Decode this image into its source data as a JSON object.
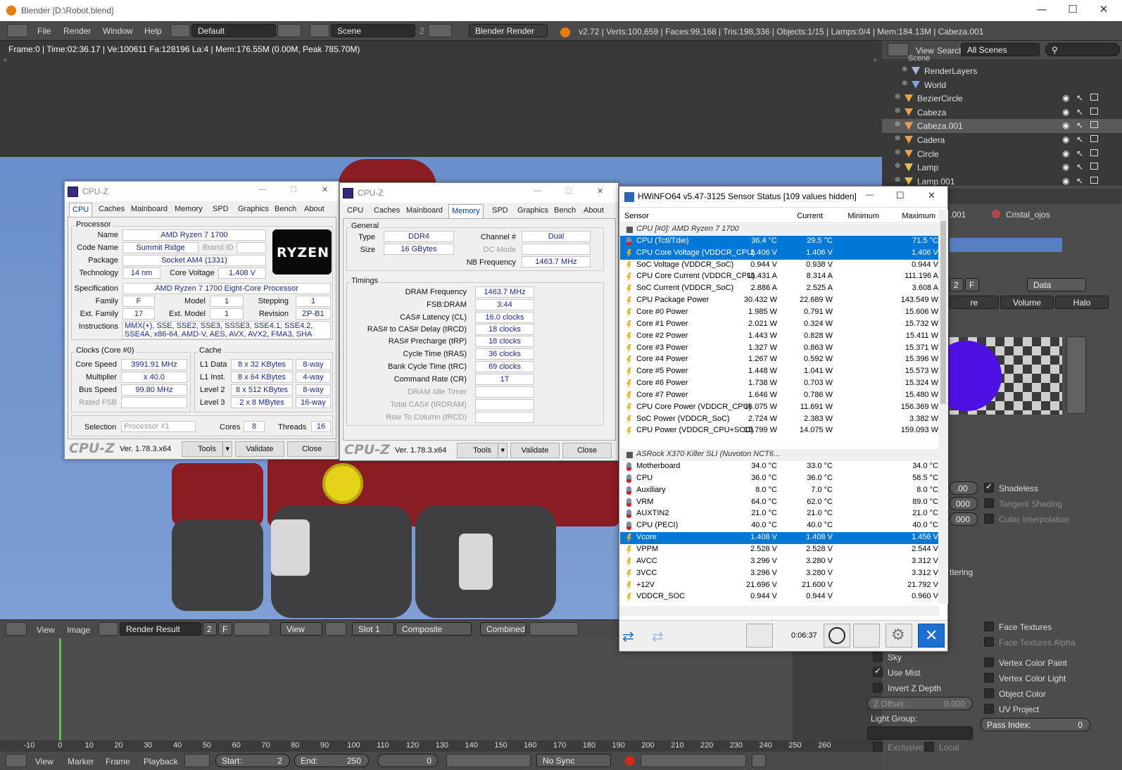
{
  "blender": {
    "title": "Blender  [D:\\Robot.blend]",
    "menu": [
      "File",
      "Render",
      "Window",
      "Help"
    ],
    "layout": "Default",
    "scene": "Scene",
    "scene_count": "2",
    "engine": "Blender Render",
    "stats": "v2.72 | Verts:100,659 | Faces:99,168 | Tris:198,336 | Objects:1/15 | Lamps:0/4 | Mem:184.13M | Cabeza.001",
    "viewport_info": "Frame:0 | Time:02:36.17 | Ve:100611 Fa:128196 La:4 | Mem:176.55M (0.00M, Peak 785.70M)",
    "image_editor": {
      "menus": [
        "View",
        "Image"
      ],
      "image_name": "Render Result",
      "users": "2",
      "fake": "F",
      "view_label": "View",
      "slot": "Slot 1",
      "composite": "Composite",
      "pass": "Combined"
    },
    "timeline": {
      "ticks": [
        "-10",
        "0",
        "10",
        "20",
        "30",
        "40",
        "50",
        "60",
        "70",
        "80",
        "90",
        "100",
        "110",
        "120",
        "130",
        "140",
        "150",
        "160",
        "170",
        "180",
        "190",
        "200",
        "210",
        "220",
        "230",
        "240",
        "250",
        "260"
      ],
      "menus": [
        "View",
        "Marker",
        "Frame",
        "Playback"
      ],
      "start_label": "Start:",
      "start": "2",
      "end_label": "End:",
      "end": "250",
      "current": "0",
      "sync": "No Sync"
    },
    "outliner": {
      "menus": [
        "View",
        "Search"
      ],
      "filter": "All Scenes",
      "top_item": "Scene",
      "items": [
        "RenderLayers",
        "World",
        "BezierCircle",
        "Cabeza",
        "Cabeza.001",
        "Cadera",
        "Circle",
        "Lamp",
        "Lamp.001"
      ]
    },
    "properties": {
      "breadcrumb_obj": ".001",
      "breadcrumb_mat": "Cristal_ojos",
      "data_dropdown": "Data",
      "tabs": [
        "re",
        "Volume",
        "Halo"
      ],
      "users": "2",
      "fake": "F",
      "shadeless": "Shadeless",
      "tangent_shading": "Tangent Shading",
      "cubic_interpolation": "Cubic Interpolation",
      "val_1": ".00",
      "val_2": "000",
      "val_3": "000",
      "scattering": "ttering",
      "face_textures": "Face Textures",
      "face_textures_alpha": "Face Textures Alpha",
      "sky": "Sky",
      "use_mist": "Use Mist",
      "vertex_color_paint": "Vertex Color Paint",
      "invert_z_depth": "Invert Z Depth",
      "vertex_color_light": "Vertex Color Light",
      "object_color": "Object Color",
      "z_offset_label": "Z Offset:",
      "z_offset": "0.000",
      "uv_project": "UV Project",
      "light_group": "Light Group:",
      "pass_index_label": "Pass Index:",
      "pass_index": "0",
      "exclusive": "Exclusive",
      "local": "Local"
    }
  },
  "cpuz1": {
    "title": "CPU-Z",
    "tabs": [
      "CPU",
      "Caches",
      "Mainboard",
      "Memory",
      "SPD",
      "Graphics",
      "Bench",
      "About"
    ],
    "processor_group": "Processor",
    "name_label": "Name",
    "name": "AMD Ryzen 7 1700",
    "codename_label": "Code Name",
    "codename": "Summit Ridge",
    "brandid_label": "Brand ID",
    "package_label": "Package",
    "package": "Socket AM4 (1331)",
    "technology_label": "Technology",
    "technology": "14 nm",
    "corevoltage_label": "Core Voltage",
    "corevoltage": "1.408 V",
    "logo_text": "RYZEN",
    "spec_label": "Specification",
    "spec": "AMD Ryzen 7 1700 Eight-Core Processor",
    "family_label": "Family",
    "family": "F",
    "model_label": "Model",
    "model": "1",
    "stepping_label": "Stepping",
    "stepping": "1",
    "extfamily_label": "Ext. Family",
    "extfamily": "17",
    "extmodel_label": "Ext. Model",
    "extmodel": "1",
    "revision_label": "Revision",
    "revision": "ZP-B1",
    "instr_label": "Instructions",
    "instr": "MMX(+), SSE, SSE2, SSE3, SSSE3, SSE4.1, SSE4.2, SSE4A, x86-64, AMD-V, AES, AVX, AVX2, FMA3, SHA",
    "clocks_group": "Clocks (Core #0)",
    "corespeed_label": "Core Speed",
    "corespeed": "3991.91 MHz",
    "multiplier_label": "Multiplier",
    "multiplier": "x 40.0",
    "busspeed_label": "Bus Speed",
    "busspeed": "99.80 MHz",
    "ratedfsb_label": "Rated FSB",
    "cache_group": "Cache",
    "l1d_label": "L1 Data",
    "l1d": "8 x 32 KBytes",
    "l1d_way": "8-way",
    "l1i_label": "L1 Inst.",
    "l1i": "8 x 64 KBytes",
    "l1i_way": "4-way",
    "l2_label": "Level 2",
    "l2": "8 x 512 KBytes",
    "l2_way": "8-way",
    "l3_label": "Level 3",
    "l3": "2 x 8 MBytes",
    "l3_way": "16-way",
    "selection_label": "Selection",
    "selection": "Processor #1",
    "cores_label": "Cores",
    "cores": "8",
    "threads_label": "Threads",
    "threads": "16",
    "brand": "CPU-Z",
    "version": "Ver. 1.78.3.x64",
    "tools": "Tools",
    "validate": "Validate",
    "close": "Close"
  },
  "cpuz2": {
    "title": "CPU-Z",
    "tabs": [
      "CPU",
      "Caches",
      "Mainboard",
      "Memory",
      "SPD",
      "Graphics",
      "Bench",
      "About"
    ],
    "general_group": "General",
    "type_label": "Type",
    "type": "DDR4",
    "channel_label": "Channel #",
    "channel": "Dual",
    "size_label": "Size",
    "size": "16 GBytes",
    "dcmode_label": "DC Mode",
    "nbfreq_label": "NB Frequency",
    "nbfreq": "1463.7 MHz",
    "timings_group": "Timings",
    "dramfreq_label": "DRAM Frequency",
    "dramfreq": "1463.7 MHz",
    "fsbdram_label": "FSB:DRAM",
    "fsbdram": "3:44",
    "cas_label": "CAS# Latency (CL)",
    "cas": "16.0 clocks",
    "trcd_label": "RAS# to CAS# Delay (tRCD)",
    "trcd": "18 clocks",
    "trp_label": "RAS# Precharge (tRP)",
    "trp": "18 clocks",
    "tras_label": "Cycle Time (tRAS)",
    "tras": "36 clocks",
    "trc_label": "Bank Cycle Time (tRC)",
    "trc": "69 clocks",
    "cr_label": "Command Rate (CR)",
    "cr": "1T",
    "idle_label": "DRAM Idle Timer",
    "totalcas_label": "Total CAS# (tRDRAM)",
    "rowcol_label": "Row To Column (tRCD)",
    "brand": "CPU-Z",
    "version": "Ver. 1.78.3.x64",
    "tools": "Tools",
    "validate": "Validate",
    "close": "Close"
  },
  "hwinfo": {
    "title": "HWiNFO64 v5.47-3125 Sensor Status [109 values hidden]",
    "columns": [
      "Sensor",
      "Current",
      "Minimum",
      "Maximum"
    ],
    "rows": [
      {
        "name": "CPU [#0]: AMD Ryzen 7 1700",
        "cur": "",
        "min": "",
        "max": "",
        "kind": "group"
      },
      {
        "name": "CPU (Tctl/Tdie)",
        "cur": "36.4 °C",
        "min": "29.5 °C",
        "max": "71.5 °C",
        "kind": "temp",
        "sel": true
      },
      {
        "name": "CPU Core Voltage (VDDCR_CPU)",
        "cur": "1.406 V",
        "min": "1.406 V",
        "max": "1.406 V",
        "kind": "volt",
        "sel": true
      },
      {
        "name": "SoC Voltage (VDDCR_SoC)",
        "cur": "0.944 V",
        "min": "0.938 V",
        "max": "0.944 V",
        "kind": "volt"
      },
      {
        "name": "CPU Core Current (VDDCR_CPU)",
        "cur": "11.431 A",
        "min": "8.314 A",
        "max": "111.196 A",
        "kind": "volt"
      },
      {
        "name": "SoC Current (VDDCR_SoC)",
        "cur": "2.886 A",
        "min": "2.525 A",
        "max": "3.608 A",
        "kind": "volt"
      },
      {
        "name": "CPU Package Power",
        "cur": "30.432 W",
        "min": "22.689 W",
        "max": "143.549 W",
        "kind": "volt"
      },
      {
        "name": "Core #0 Power",
        "cur": "1.985 W",
        "min": "0.791 W",
        "max": "15.606 W",
        "kind": "volt"
      },
      {
        "name": "Core #1 Power",
        "cur": "2.021 W",
        "min": "0.324 W",
        "max": "15.732 W",
        "kind": "volt"
      },
      {
        "name": "Core #2 Power",
        "cur": "1.443 W",
        "min": "0.828 W",
        "max": "15.411 W",
        "kind": "volt"
      },
      {
        "name": "Core #3 Power",
        "cur": "1.327 W",
        "min": "0.863 W",
        "max": "15.371 W",
        "kind": "volt"
      },
      {
        "name": "Core #4 Power",
        "cur": "1.267 W",
        "min": "0.592 W",
        "max": "15.396 W",
        "kind": "volt"
      },
      {
        "name": "Core #5 Power",
        "cur": "1.448 W",
        "min": "1.041 W",
        "max": "15.573 W",
        "kind": "volt"
      },
      {
        "name": "Core #6 Power",
        "cur": "1.738 W",
        "min": "0.703 W",
        "max": "15.324 W",
        "kind": "volt"
      },
      {
        "name": "Core #7 Power",
        "cur": "1.646 W",
        "min": "0.786 W",
        "max": "15.480 W",
        "kind": "volt"
      },
      {
        "name": "CPU Core Power (VDDCR_CPU)",
        "cur": "16.075 W",
        "min": "11.691 W",
        "max": "156.369 W",
        "kind": "volt"
      },
      {
        "name": "SoC Power (VDDCR_SoC)",
        "cur": "2.724 W",
        "min": "2.383 W",
        "max": "3.382 W",
        "kind": "volt"
      },
      {
        "name": "CPU Power (VDDCR_CPU+SOC)",
        "cur": "18.799 W",
        "min": "14.075 W",
        "max": "159.093 W",
        "kind": "volt"
      },
      {
        "name": "",
        "cur": "",
        "min": "",
        "max": "",
        "kind": "blank"
      },
      {
        "name": "ASRock X370 Killer SLI (Nuvoton NCT6...",
        "cur": "",
        "min": "",
        "max": "",
        "kind": "group"
      },
      {
        "name": "Motherboard",
        "cur": "34.0 °C",
        "min": "33.0 °C",
        "max": "34.0 °C",
        "kind": "temp"
      },
      {
        "name": "CPU",
        "cur": "36.0 °C",
        "min": "36.0 °C",
        "max": "58.5 °C",
        "kind": "temp"
      },
      {
        "name": "Auxiliary",
        "cur": "8.0 °C",
        "min": "7.0 °C",
        "max": "8.0 °C",
        "kind": "temp"
      },
      {
        "name": "VRM",
        "cur": "64.0 °C",
        "min": "62.0 °C",
        "max": "89.0 °C",
        "kind": "temp"
      },
      {
        "name": "AUXTIN2",
        "cur": "21.0 °C",
        "min": "21.0 °C",
        "max": "21.0 °C",
        "kind": "temp"
      },
      {
        "name": "CPU (PECI)",
        "cur": "40.0 °C",
        "min": "40.0 °C",
        "max": "40.0 °C",
        "kind": "temp"
      },
      {
        "name": "Vcore",
        "cur": "1.408 V",
        "min": "1.408 V",
        "max": "1.456 V",
        "kind": "volt",
        "sel": true
      },
      {
        "name": "VPPM",
        "cur": "2.528 V",
        "min": "2.528 V",
        "max": "2.544 V",
        "kind": "volt"
      },
      {
        "name": "AVCC",
        "cur": "3.296 V",
        "min": "3.280 V",
        "max": "3.312 V",
        "kind": "volt"
      },
      {
        "name": "3VCC",
        "cur": "3.296 V",
        "min": "3.280 V",
        "max": "3.312 V",
        "kind": "volt"
      },
      {
        "name": "+12V",
        "cur": "21.696 V",
        "min": "21.600 V",
        "max": "21.792 V",
        "kind": "volt"
      },
      {
        "name": "VDDCR_SOC",
        "cur": "0.944 V",
        "min": "0.944 V",
        "max": "0.960 V",
        "kind": "volt"
      }
    ],
    "elapsed": "0:06:37"
  }
}
